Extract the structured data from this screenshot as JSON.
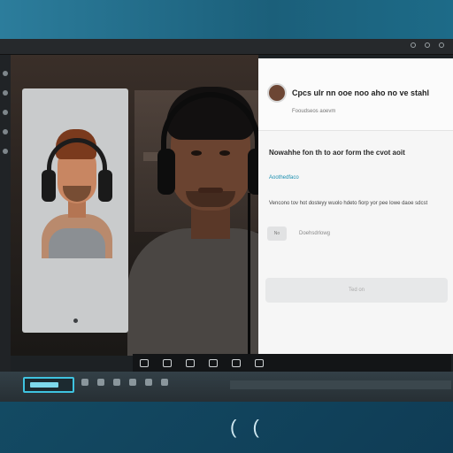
{
  "panel": {
    "title": "Cpcs ulr nn ooe noo aho no ve stahl",
    "subtitle": "Fooudseos aoevm",
    "message": "Nowahhe fon th to aor form the cvot aoit",
    "link": "Aoothedfaco",
    "description": "Vencono tov hot dosteyy wuolo hdeto fiorp yor pee lowe daoe sdcst",
    "chip": "No",
    "row_label": "Doehsdrlowg",
    "button": "Ted on"
  },
  "colors": {
    "accent": "#3fc3e0",
    "link": "#1b8fb0",
    "panel_bg": "#f6f6f6",
    "desktop": "#1f6a86"
  },
  "icons": {
    "rail": [
      "circle-icon",
      "circle-icon",
      "circle-icon",
      "circle-icon",
      "circle-icon"
    ],
    "controls": [
      "mic-icon",
      "camera-icon",
      "share-icon",
      "chat-icon",
      "record-icon",
      "more-icon"
    ]
  },
  "cursor": "( (",
  "taskbar_active": "video-call-app"
}
